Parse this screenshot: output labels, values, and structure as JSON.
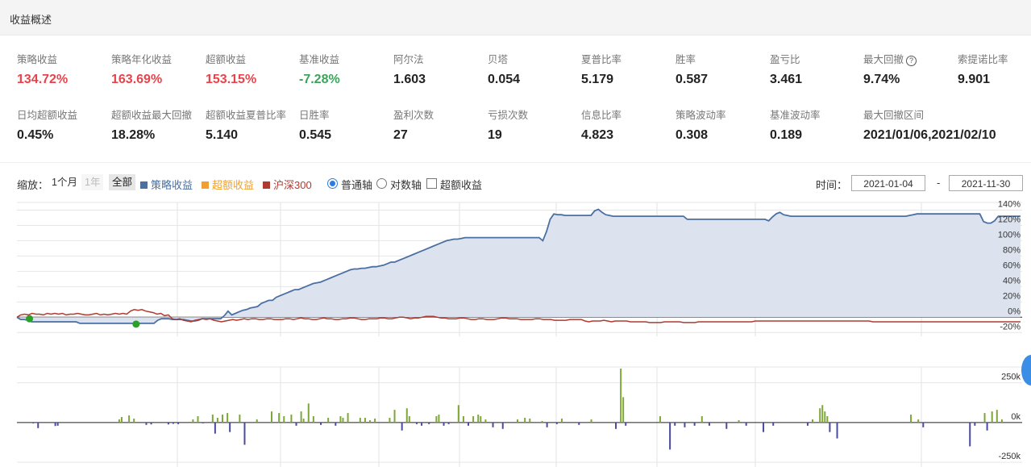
{
  "header": {
    "title": "收益概述"
  },
  "metrics_row1": [
    {
      "label": "策略收益",
      "value": "134.72%",
      "tone": "red"
    },
    {
      "label": "策略年化收益",
      "value": "163.69%",
      "tone": "red"
    },
    {
      "label": "超额收益",
      "value": "153.15%",
      "tone": "red"
    },
    {
      "label": "基准收益",
      "value": "-7.28%",
      "tone": "green"
    },
    {
      "label": "阿尔法",
      "value": "1.603",
      "tone": "normal"
    },
    {
      "label": "贝塔",
      "value": "0.054",
      "tone": "normal"
    },
    {
      "label": "夏普比率",
      "value": "5.179",
      "tone": "normal"
    },
    {
      "label": "胜率",
      "value": "0.587",
      "tone": "normal"
    },
    {
      "label": "盈亏比",
      "value": "3.461",
      "tone": "normal"
    },
    {
      "label": "最大回撤",
      "value": "9.74%",
      "tone": "normal",
      "help_icon": "question-icon"
    },
    {
      "label": "索提诺比率",
      "value": "9.901",
      "tone": "normal"
    }
  ],
  "metrics_row2": [
    {
      "label": "日均超额收益",
      "value": "0.45%"
    },
    {
      "label": "超额收益最大回撤",
      "value": "18.28%"
    },
    {
      "label": "超额收益夏普比率",
      "value": "5.140"
    },
    {
      "label": "日胜率",
      "value": "0.545"
    },
    {
      "label": "盈利次数",
      "value": "27"
    },
    {
      "label": "亏损次数",
      "value": "19"
    },
    {
      "label": "信息比率",
      "value": "4.823"
    },
    {
      "label": "策略波动率",
      "value": "0.308"
    },
    {
      "label": "基准波动率",
      "value": "0.189"
    },
    {
      "label": "最大回撤区间",
      "value": "2021/01/06,2021/02/10"
    }
  ],
  "toolbar": {
    "zoom_label": "缩放：",
    "zoom_options": [
      "1个月",
      "1年",
      "全部"
    ],
    "zoom_selected": "全部",
    "legend": [
      {
        "label": "策略收益",
        "color": "#4a6fa0"
      },
      {
        "label": "超额收益",
        "color": "#f0a030"
      },
      {
        "label": "沪深300",
        "color": "#b03a30"
      }
    ],
    "axis_normal": "普通轴",
    "axis_log": "对数轴",
    "axis_selected": "普通轴",
    "excess_checkbox": "超额收益",
    "excess_checked": false,
    "time_label": "时间：",
    "date_from": "2021-01-04",
    "date_sep": "-",
    "date_to": "2021-11-30"
  },
  "chart_data": [
    {
      "type": "area",
      "x_start": "2021-01-04",
      "x_end": "2021-11-30",
      "y_unit": "%",
      "ylim": [
        -25,
        150
      ],
      "y_ticks": [
        "-20%",
        "0%",
        "20%",
        "40%",
        "60%",
        "80%",
        "100%",
        "120%",
        "140%"
      ],
      "grid": true,
      "series": [
        {
          "name": "策略收益",
          "color": "#4a6fa0",
          "values": [
            0,
            -3,
            -3,
            -4,
            -6,
            -6,
            -6,
            -6,
            -6,
            -6,
            -6,
            -6,
            -6,
            -6,
            -6,
            -6,
            -6,
            -8,
            -8,
            -8,
            -8,
            -8,
            -8,
            -8,
            -8,
            -8,
            -8,
            -8,
            -8,
            -8,
            -8,
            -8,
            -8,
            -8,
            -8,
            -8,
            -8,
            -8,
            -4,
            -2,
            -2,
            -2,
            -3,
            -3,
            -3,
            -3,
            -4,
            -5,
            -5,
            -4,
            -2,
            -2,
            -2,
            -2,
            -2,
            -2,
            2,
            8,
            3,
            5,
            7,
            9,
            10,
            12,
            13,
            14,
            18,
            20,
            22,
            22,
            26,
            28,
            30,
            32,
            34,
            36,
            36,
            38,
            40,
            42,
            44,
            45,
            46,
            48,
            50,
            52,
            54,
            56,
            58,
            60,
            62,
            63,
            63,
            64,
            64,
            65,
            66,
            66,
            67,
            68,
            70,
            72,
            72,
            74,
            76,
            78,
            80,
            82,
            84,
            86,
            88,
            90,
            92,
            94,
            96,
            98,
            100,
            101,
            102,
            102,
            103,
            104,
            104,
            104,
            104,
            104,
            104,
            104,
            104,
            104,
            104,
            104,
            104,
            104,
            104,
            104,
            104,
            104,
            104,
            104,
            104,
            104,
            100,
            112,
            128,
            135,
            134,
            134,
            133,
            133,
            133,
            133,
            133,
            133,
            133,
            133,
            139,
            141,
            137,
            134,
            133,
            132,
            132,
            132,
            132,
            132,
            132,
            132,
            132,
            132,
            132,
            132,
            132,
            132,
            132,
            132,
            132,
            132,
            132,
            132,
            132,
            128,
            128,
            128,
            128,
            128,
            128,
            128,
            128,
            128,
            128,
            128,
            128,
            128,
            128,
            128,
            128,
            128,
            128,
            128,
            128,
            128,
            128,
            126,
            131,
            135,
            137,
            134,
            133,
            132,
            132,
            132,
            132,
            132,
            132,
            132,
            132,
            132,
            132,
            132,
            132,
            132,
            132,
            132,
            132,
            132,
            132,
            132,
            132,
            132,
            132,
            132,
            132,
            132,
            132,
            132,
            132,
            132,
            132,
            132,
            132,
            133,
            134,
            135,
            135,
            135,
            135,
            135,
            135,
            135,
            135,
            135,
            135,
            135,
            135,
            135,
            135,
            135,
            135,
            135,
            135,
            125,
            123,
            123,
            126,
            132,
            132,
            132,
            132,
            132,
            132,
            132
          ]
        },
        {
          "name": "沪深300",
          "color": "#b03a30",
          "values": [
            0,
            3,
            4,
            3,
            5,
            4,
            4,
            3,
            5,
            4,
            5,
            4,
            5,
            3,
            4,
            4,
            5,
            4,
            3,
            3,
            4,
            5,
            3,
            4,
            3,
            4,
            5,
            4,
            5,
            4,
            8,
            10,
            9,
            10,
            8,
            7,
            6,
            4,
            5,
            2,
            3,
            -2,
            -3,
            -2,
            -4,
            -5,
            -6,
            -4,
            -3,
            -2,
            -3,
            -2,
            -4,
            -5,
            -6,
            -5,
            -4,
            -3,
            -4,
            -3,
            -2,
            -3,
            -2,
            -2,
            -3,
            -3,
            -2,
            -2,
            -3,
            -3,
            -3,
            -2,
            -2,
            -3,
            -2,
            -1,
            -2,
            -2,
            -3,
            -3,
            -2,
            -1,
            -2,
            -2,
            -3,
            -3,
            -2,
            -2,
            -1,
            -1,
            -2,
            -3,
            -3,
            -2,
            -2,
            -2,
            -1,
            -1,
            -2,
            -2,
            -1,
            0,
            0,
            -1,
            -2,
            -1,
            -1,
            0,
            1,
            1,
            1,
            0,
            -1,
            -1,
            -2,
            -2,
            -2,
            -1,
            -1,
            -2,
            -3,
            -3,
            -2,
            -2,
            -3,
            -3,
            -3,
            -2,
            -1,
            -1,
            -2,
            -2,
            -2,
            -3,
            -3,
            -3,
            -3,
            -2,
            -2,
            -3,
            -3,
            -3,
            -4,
            -4,
            -4,
            -4,
            -3,
            -3,
            -3,
            -3,
            -5,
            -6,
            -5,
            -5,
            -5,
            -4,
            -5,
            -6,
            -5,
            -5,
            -5,
            -5,
            -6,
            -6,
            -6,
            -6,
            -6,
            -7,
            -7,
            -7,
            -7,
            -6,
            -6,
            -6,
            -6,
            -6,
            -7,
            -7,
            -7,
            -7,
            -6,
            -6,
            -6,
            -6,
            -6,
            -6,
            -6,
            -6,
            -6,
            -6,
            -6,
            -6,
            -6,
            -6,
            -6,
            -5,
            -5,
            -5,
            -5,
            -5,
            -5,
            -5,
            -5,
            -5,
            -5,
            -5,
            -5,
            -5,
            -5,
            -5,
            -5,
            -5,
            -5,
            -5,
            -5,
            -5,
            -5,
            -5,
            -5,
            -5,
            -5,
            -5,
            -5,
            -5,
            -5,
            -5,
            -6,
            -6,
            -6,
            -6,
            -6,
            -6,
            -6,
            -6,
            -6,
            -6,
            -6,
            -6,
            -6,
            -6,
            -6,
            -6,
            -6,
            -6,
            -6,
            -6,
            -6,
            -6,
            -6,
            -6,
            -6,
            -6,
            -6,
            -6,
            -6,
            -6,
            -6,
            -6,
            -6,
            -6,
            -6,
            -6,
            -6,
            -6,
            -6,
            -6
          ]
        }
      ],
      "markers": [
        {
          "date": "2021-01-06",
          "value": -2,
          "color": "#2aa02a"
        },
        {
          "date": "2021-02-10",
          "value": -9,
          "color": "#2aa02a"
        }
      ]
    },
    {
      "type": "bar",
      "y_unit": "k",
      "ylim": [
        -280,
        350
      ],
      "y_ticks": [
        "-250k",
        "0k",
        "250k"
      ],
      "positive_color": "#7ea63a",
      "negative_color": "#4a4aa0",
      "bars": [
        {
          "i": 3,
          "v": -5
        },
        {
          "i": 5,
          "v": -35
        },
        {
          "i": 12,
          "v": -22
        },
        {
          "i": 13,
          "v": -20
        },
        {
          "i": 38,
          "v": 20
        },
        {
          "i": 39,
          "v": 35
        },
        {
          "i": 42,
          "v": 45
        },
        {
          "i": 44,
          "v": 25
        },
        {
          "i": 49,
          "v": -15
        },
        {
          "i": 51,
          "v": -12
        },
        {
          "i": 58,
          "v": -12
        },
        {
          "i": 60,
          "v": -8
        },
        {
          "i": 62,
          "v": -10
        },
        {
          "i": 68,
          "v": 20
        },
        {
          "i": 70,
          "v": 40
        },
        {
          "i": 72,
          "v": -5
        },
        {
          "i": 76,
          "v": 50
        },
        {
          "i": 77,
          "v": -70
        },
        {
          "i": 78,
          "v": 30
        },
        {
          "i": 80,
          "v": 50
        },
        {
          "i": 82,
          "v": 60
        },
        {
          "i": 83,
          "v": -60
        },
        {
          "i": 87,
          "v": 50
        },
        {
          "i": 89,
          "v": -140
        },
        {
          "i": 94,
          "v": 20
        },
        {
          "i": 100,
          "v": 70
        },
        {
          "i": 103,
          "v": 60
        },
        {
          "i": 105,
          "v": 40
        },
        {
          "i": 108,
          "v": 50
        },
        {
          "i": 110,
          "v": -20
        },
        {
          "i": 112,
          "v": 70
        },
        {
          "i": 113,
          "v": 25
        },
        {
          "i": 115,
          "v": 120
        },
        {
          "i": 117,
          "v": 40
        },
        {
          "i": 120,
          "v": -15
        },
        {
          "i": 123,
          "v": 30
        },
        {
          "i": 126,
          "v": -20
        },
        {
          "i": 128,
          "v": 40
        },
        {
          "i": 129,
          "v": 30
        },
        {
          "i": 131,
          "v": 60
        },
        {
          "i": 136,
          "v": 30
        },
        {
          "i": 138,
          "v": 30
        },
        {
          "i": 140,
          "v": 15
        },
        {
          "i": 142,
          "v": 25
        },
        {
          "i": 148,
          "v": 30
        },
        {
          "i": 150,
          "v": 80
        },
        {
          "i": 153,
          "v": -50
        },
        {
          "i": 155,
          "v": 90
        },
        {
          "i": 156,
          "v": 40
        },
        {
          "i": 159,
          "v": -10
        },
        {
          "i": 161,
          "v": -20
        },
        {
          "i": 164,
          "v": -10
        },
        {
          "i": 167,
          "v": 40
        },
        {
          "i": 168,
          "v": 50
        },
        {
          "i": 170,
          "v": -20
        },
        {
          "i": 172,
          "v": -10
        },
        {
          "i": 176,
          "v": 110
        },
        {
          "i": 178,
          "v": 40
        },
        {
          "i": 180,
          "v": -20
        },
        {
          "i": 182,
          "v": 40
        },
        {
          "i": 184,
          "v": 50
        },
        {
          "i": 185,
          "v": 40
        },
        {
          "i": 187,
          "v": 20
        },
        {
          "i": 190,
          "v": -30
        },
        {
          "i": 194,
          "v": -40
        },
        {
          "i": 200,
          "v": 20
        },
        {
          "i": 203,
          "v": 30
        },
        {
          "i": 205,
          "v": 25
        },
        {
          "i": 210,
          "v": 10
        },
        {
          "i": 212,
          "v": -30
        },
        {
          "i": 216,
          "v": -10
        },
        {
          "i": 218,
          "v": 25
        },
        {
          "i": 225,
          "v": -15
        },
        {
          "i": 230,
          "v": 20
        },
        {
          "i": 240,
          "v": -40
        },
        {
          "i": 242,
          "v": 340
        },
        {
          "i": 243,
          "v": 160
        },
        {
          "i": 244,
          "v": -20
        },
        {
          "i": 258,
          "v": 40
        },
        {
          "i": 262,
          "v": -170
        },
        {
          "i": 264,
          "v": -20
        },
        {
          "i": 268,
          "v": -30
        },
        {
          "i": 272,
          "v": -20
        },
        {
          "i": 275,
          "v": 40
        },
        {
          "i": 278,
          "v": -20
        },
        {
          "i": 285,
          "v": -40
        },
        {
          "i": 290,
          "v": 15
        },
        {
          "i": 293,
          "v": -20
        },
        {
          "i": 300,
          "v": -60
        },
        {
          "i": 304,
          "v": -20
        },
        {
          "i": 318,
          "v": -20
        },
        {
          "i": 320,
          "v": 20
        },
        {
          "i": 323,
          "v": 90
        },
        {
          "i": 324,
          "v": 110
        },
        {
          "i": 325,
          "v": 70
        },
        {
          "i": 326,
          "v": 40
        },
        {
          "i": 327,
          "v": -60
        },
        {
          "i": 330,
          "v": -100
        },
        {
          "i": 360,
          "v": 50
        },
        {
          "i": 363,
          "v": 20
        },
        {
          "i": 365,
          "v": -30
        },
        {
          "i": 384,
          "v": -150
        },
        {
          "i": 386,
          "v": -20
        },
        {
          "i": 390,
          "v": 60
        },
        {
          "i": 391,
          "v": -50
        },
        {
          "i": 393,
          "v": 70
        },
        {
          "i": 395,
          "v": 80
        },
        {
          "i": 397,
          "v": 20
        }
      ],
      "n": 400
    }
  ]
}
